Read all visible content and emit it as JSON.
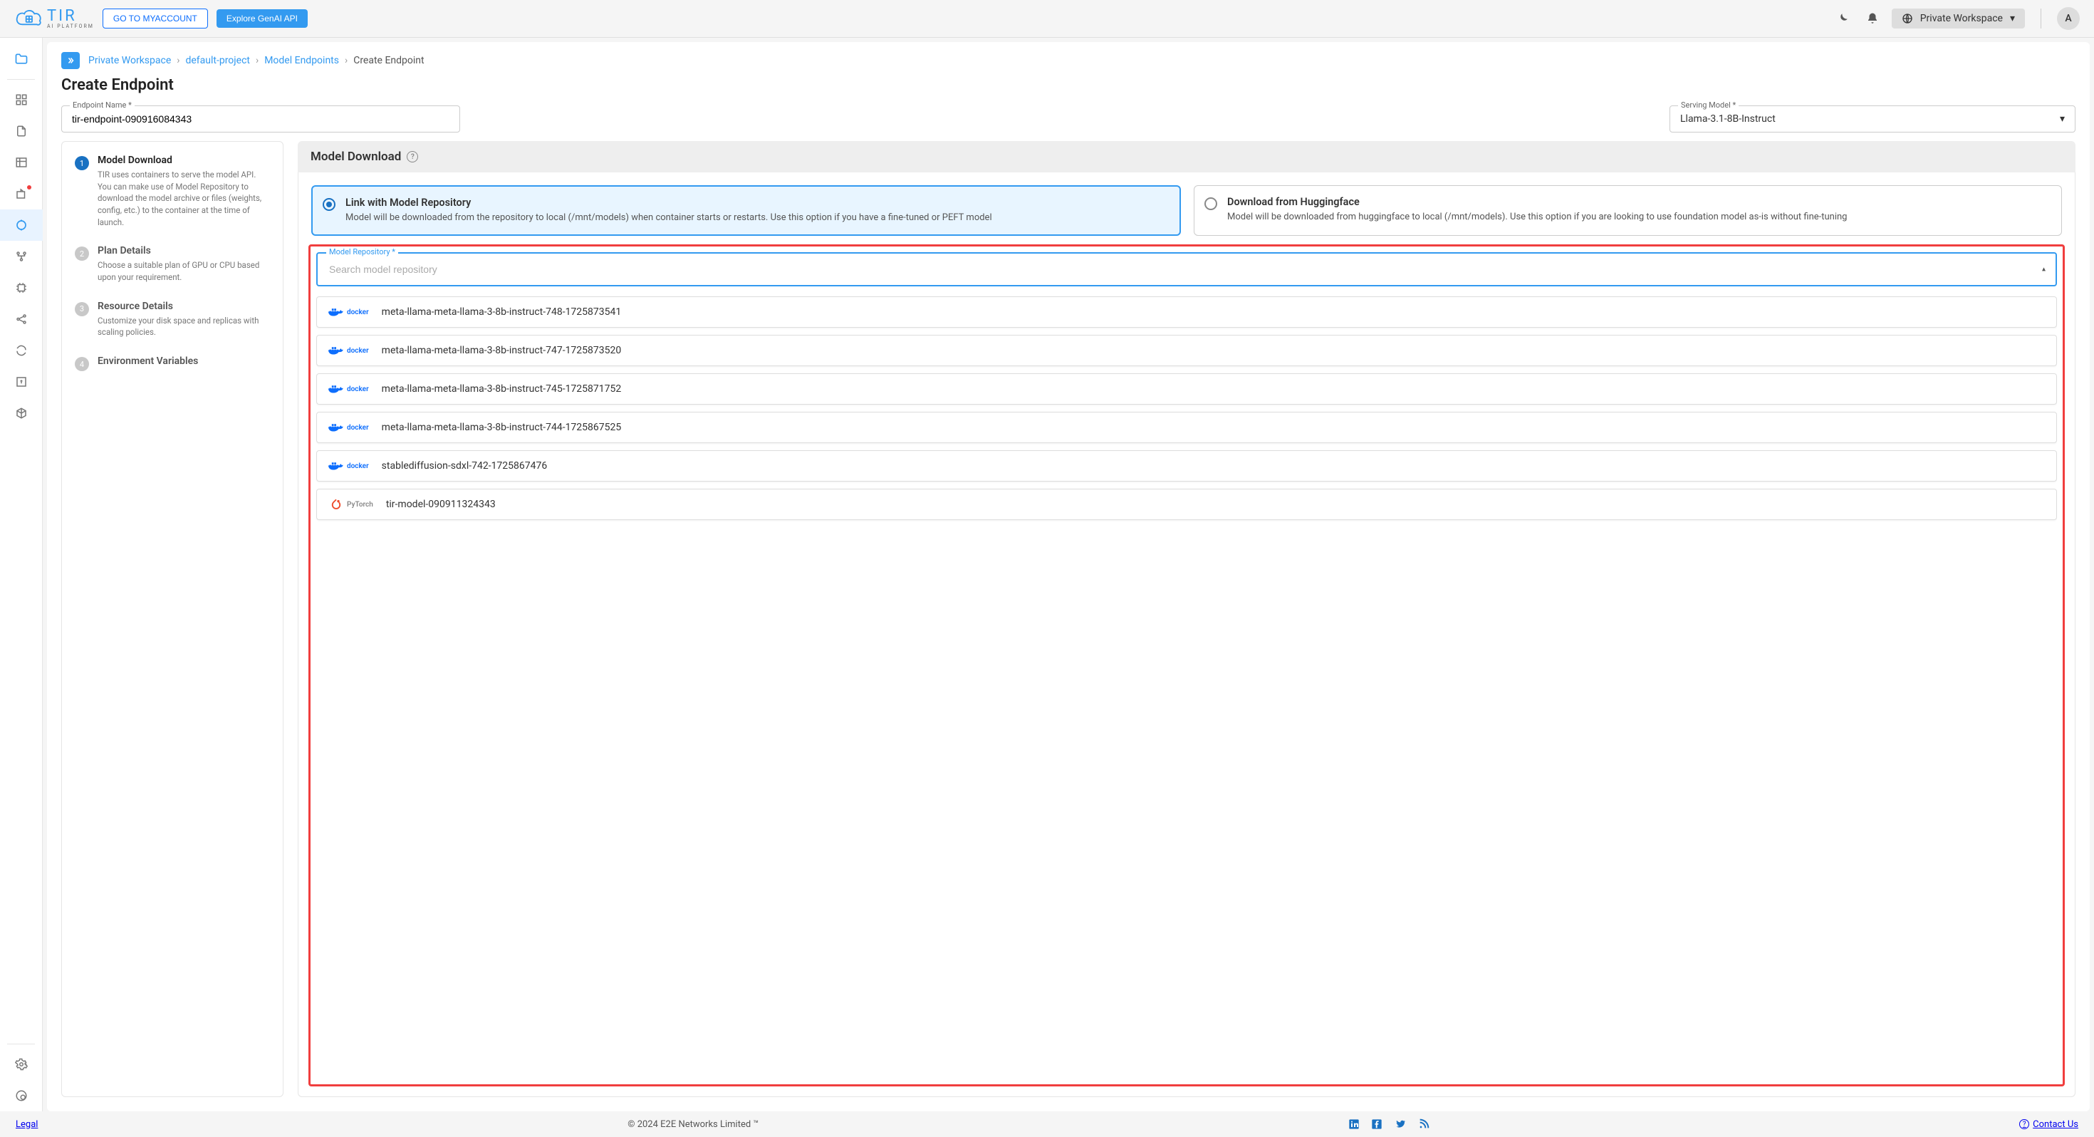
{
  "header": {
    "logo_main": "TIR",
    "logo_sub": "AI PLATFORM",
    "myaccount": "GO TO MYACCOUNT",
    "explore": "Explore GenAI API",
    "workspace": "Private Workspace",
    "avatar": "A"
  },
  "breadcrumb": {
    "items": [
      "Private Workspace",
      "default-project",
      "Model Endpoints"
    ],
    "current": "Create Endpoint"
  },
  "page_title": "Create Endpoint",
  "fields": {
    "endpoint_label": "Endpoint Name *",
    "endpoint_value": "tir-endpoint-090916084343",
    "model_label": "Serving Model *",
    "model_value": "Llama-3.1-8B-Instruct"
  },
  "steps": [
    {
      "title": "Model Download",
      "desc": "TIR uses containers to serve the model API. You can make use of Model Repository to download the model archive or files (weights, config, etc.) to the container at the time of launch."
    },
    {
      "title": "Plan Details",
      "desc": "Choose a suitable plan of GPU or CPU based upon your requirement."
    },
    {
      "title": "Resource Details",
      "desc": "Customize your disk space and replicas with scaling policies."
    },
    {
      "title": "Environment Variables",
      "desc": ""
    }
  ],
  "panel": {
    "title": "Model Download",
    "options": [
      {
        "title": "Link with Model Repository",
        "desc": "Model will be downloaded from the repository to local (/mnt/models) when container starts or restarts. Use this option if you have a fine-tuned or PEFT model"
      },
      {
        "title": "Download from Huggingface",
        "desc": "Model will be downloaded from huggingface to local (/mnt/models). Use this option if you are looking to use foundation model as-is without fine-tuning"
      }
    ],
    "repo_label": "Model Repository *",
    "repo_placeholder": "Search model repository",
    "repos": [
      {
        "kind": "docker",
        "name": "meta-llama-meta-llama-3-8b-instruct-748-1725873541"
      },
      {
        "kind": "docker",
        "name": "meta-llama-meta-llama-3-8b-instruct-747-1725873520"
      },
      {
        "kind": "docker",
        "name": "meta-llama-meta-llama-3-8b-instruct-745-1725871752"
      },
      {
        "kind": "docker",
        "name": "meta-llama-meta-llama-3-8b-instruct-744-1725867525"
      },
      {
        "kind": "docker",
        "name": "stablediffusion-sdxl-742-1725867476"
      },
      {
        "kind": "pytorch",
        "name": "tir-model-090911324343"
      }
    ]
  },
  "footer": {
    "legal": "Legal",
    "copyright": "© 2024 E2E Networks Limited ™",
    "contact": "Contact Us"
  }
}
